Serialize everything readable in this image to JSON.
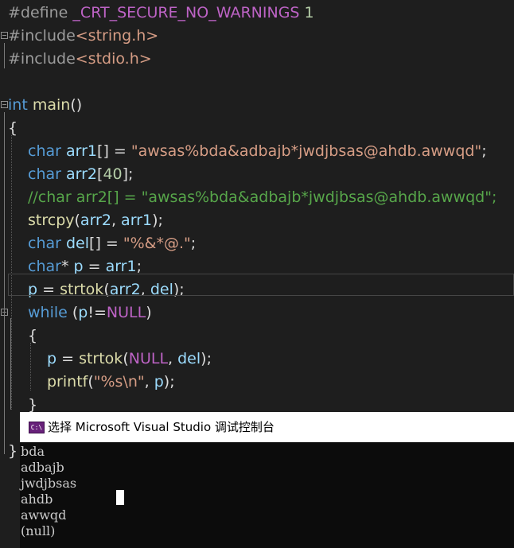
{
  "editor": {
    "lines": [
      [
        {
          "t": "#define ",
          "c": "pre"
        },
        {
          "t": "_CRT_SECURE_NO_WARNINGS",
          "c": "mac"
        },
        {
          "t": " ",
          "c": "plain"
        },
        {
          "t": "1",
          "c": "num"
        }
      ],
      [
        {
          "t": "#include",
          "c": "pre"
        },
        {
          "t": "<string.h>",
          "c": "inc"
        }
      ],
      [
        {
          "t": "#include",
          "c": "pre"
        },
        {
          "t": "<stdio.h>",
          "c": "inc"
        }
      ],
      [],
      [
        {
          "t": "int",
          "c": "kw"
        },
        {
          "t": " ",
          "c": "plain"
        },
        {
          "t": "main",
          "c": "fn"
        },
        {
          "t": "()",
          "c": "plain"
        }
      ],
      [
        {
          "t": "{",
          "c": "plain"
        }
      ],
      [
        {
          "t": "char",
          "c": "kw"
        },
        {
          "t": " ",
          "c": "plain"
        },
        {
          "t": "arr1",
          "c": "var"
        },
        {
          "t": "[] = ",
          "c": "plain"
        },
        {
          "t": "\"awsas%bda&adbajb*jwdjbsas@ahdb.awwqd\"",
          "c": "str"
        },
        {
          "t": ";",
          "c": "plain"
        }
      ],
      [
        {
          "t": "char",
          "c": "kw"
        },
        {
          "t": " ",
          "c": "plain"
        },
        {
          "t": "arr2",
          "c": "var"
        },
        {
          "t": "[",
          "c": "plain"
        },
        {
          "t": "40",
          "c": "num"
        },
        {
          "t": "];",
          "c": "plain"
        }
      ],
      [
        {
          "t": "//char arr2[] = \"awsas%bda&adbajb*jwdjbsas@ahdb.awwqd\";",
          "c": "cmt"
        }
      ],
      [
        {
          "t": "strcpy",
          "c": "fn"
        },
        {
          "t": "(",
          "c": "plain"
        },
        {
          "t": "arr2",
          "c": "var"
        },
        {
          "t": ", ",
          "c": "plain"
        },
        {
          "t": "arr1",
          "c": "var"
        },
        {
          "t": ");",
          "c": "plain"
        }
      ],
      [
        {
          "t": "char",
          "c": "kw"
        },
        {
          "t": " ",
          "c": "plain"
        },
        {
          "t": "del",
          "c": "var"
        },
        {
          "t": "[] = ",
          "c": "plain"
        },
        {
          "t": "\"%&*@.\"",
          "c": "str"
        },
        {
          "t": ";",
          "c": "plain"
        }
      ],
      [
        {
          "t": "char",
          "c": "kw"
        },
        {
          "t": "* ",
          "c": "plain"
        },
        {
          "t": "p",
          "c": "var"
        },
        {
          "t": " = ",
          "c": "plain"
        },
        {
          "t": "arr1",
          "c": "var"
        },
        {
          "t": ";",
          "c": "plain"
        }
      ],
      [
        {
          "t": "p",
          "c": "var"
        },
        {
          "t": " = ",
          "c": "plain"
        },
        {
          "t": "strtok",
          "c": "fn"
        },
        {
          "t": "(",
          "c": "plain"
        },
        {
          "t": "arr2",
          "c": "var"
        },
        {
          "t": ", ",
          "c": "plain"
        },
        {
          "t": "del",
          "c": "var"
        },
        {
          "t": ");",
          "c": "plain"
        }
      ],
      [
        {
          "t": "while",
          "c": "kw"
        },
        {
          "t": " (",
          "c": "plain"
        },
        {
          "t": "p",
          "c": "var"
        },
        {
          "t": "!=",
          "c": "plain"
        },
        {
          "t": "NULL",
          "c": "mac"
        },
        {
          "t": ")",
          "c": "plain"
        }
      ],
      [
        {
          "t": "{",
          "c": "plain"
        }
      ],
      [
        {
          "t": "p",
          "c": "var"
        },
        {
          "t": " = ",
          "c": "plain"
        },
        {
          "t": "strtok",
          "c": "fn"
        },
        {
          "t": "(",
          "c": "plain"
        },
        {
          "t": "NULL",
          "c": "mac"
        },
        {
          "t": ", ",
          "c": "plain"
        },
        {
          "t": "del",
          "c": "var"
        },
        {
          "t": ");",
          "c": "plain"
        }
      ],
      [
        {
          "t": "printf",
          "c": "fn"
        },
        {
          "t": "(",
          "c": "plain"
        },
        {
          "t": "\"%s\\n\"",
          "c": "str"
        },
        {
          "t": ", ",
          "c": "plain"
        },
        {
          "t": "p",
          "c": "var"
        },
        {
          "t": ");",
          "c": "plain"
        }
      ],
      [
        {
          "t": "}",
          "c": "plain"
        }
      ],
      [],
      [
        {
          "t": "}",
          "c": "plain"
        }
      ]
    ]
  },
  "console": {
    "title": "选择 Microsoft Visual Studio 调试控制台",
    "icon_text": "C:\\",
    "output": [
      "bda",
      "adbajb",
      "jwdjbsas",
      "ahdb",
      "awwqd",
      "(null)"
    ]
  },
  "colors": {
    "background": "#1e1e1e",
    "keyword": "#569cd6",
    "variable": "#9cdcfe",
    "function": "#dcdcaa",
    "string": "#d69d85",
    "comment": "#57a64a",
    "macro": "#bd63c5"
  }
}
